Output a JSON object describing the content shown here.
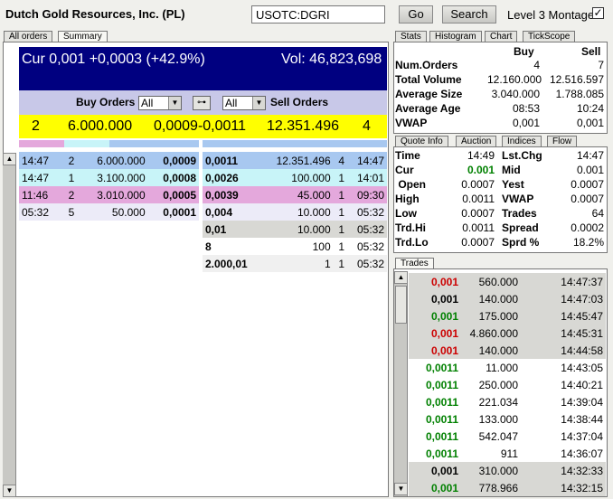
{
  "header": {
    "company": "Dutch Gold Resources, Inc. (PL)",
    "symbol": "USOTC:DGRI",
    "go_label": "Go",
    "search_label": "Search",
    "level3_label": "Level 3 Montage",
    "level3_checked": "✓"
  },
  "left_tabs": [
    "All orders",
    "Summary"
  ],
  "summary": {
    "cur": "Cur 0,001 +0,0003 (+42.9%)",
    "vol": "Vol: 46,823,698",
    "buy_orders_label": "Buy Orders",
    "sell_orders_label": "Sell Orders",
    "buy_filter": "All",
    "sell_filter": "All",
    "buy_count": "2",
    "buy_size": "6.000.000",
    "spread": "0,0009-0,0011",
    "sell_size": "12.351.496",
    "sell_count": "4"
  },
  "bids": [
    {
      "time": "14:47",
      "n": "2",
      "size": "6.000.000",
      "price": "0,0009",
      "bg": "#a8c8f0"
    },
    {
      "time": "14:47",
      "n": "1",
      "size": "3.100.000",
      "price": "0,0008",
      "bg": "#c8f4f8"
    },
    {
      "time": "11:46",
      "n": "2",
      "size": "3.010.000",
      "price": "0,0005",
      "bg": "#e4a8dc"
    },
    {
      "time": "05:32",
      "n": "5",
      "size": "50.000",
      "price": "0,0001",
      "bg": "#ecebf8"
    }
  ],
  "asks": [
    {
      "price": "0,0011",
      "size": "12.351.496",
      "n": "4",
      "time": "14:47",
      "bg": "#a8c8f0"
    },
    {
      "price": "0,0026",
      "size": "100.000",
      "n": "1",
      "time": "14:01",
      "bg": "#c8f4f8"
    },
    {
      "price": "0,0039",
      "size": "45.000",
      "n": "1",
      "time": "09:30",
      "bg": "#e4a8dc"
    },
    {
      "price": "0,004",
      "size": "10.000",
      "n": "1",
      "time": "05:32",
      "bg": "#ecebf8"
    },
    {
      "price": "0,01",
      "size": "10.000",
      "n": "1",
      "time": "05:32",
      "bg": "#d8d8d4"
    },
    {
      "price": "8",
      "size": "100",
      "n": "1",
      "time": "05:32",
      "bg": "#ffffff"
    },
    {
      "price": "2.000,01",
      "size": "1",
      "n": "1",
      "time": "05:32",
      "bg": "#f0f0f0"
    }
  ],
  "stats_tabs": [
    "Stats",
    "Histogram",
    "Chart",
    "TickScope"
  ],
  "stats": {
    "buy_label": "Buy",
    "sell_label": "Sell",
    "rows": [
      {
        "label": "Num.Orders",
        "buy": "4",
        "sell": "7"
      },
      {
        "label": "Total Volume",
        "buy": "12.160.000",
        "sell": "12.516.597"
      },
      {
        "label": "Average Size",
        "buy": "3.040.000",
        "sell": "1.788.085"
      },
      {
        "label": "Average Age",
        "buy": "08:53",
        "sell": "10:24"
      },
      {
        "label": "VWAP",
        "buy": "0,001",
        "sell": "0,001"
      }
    ]
  },
  "quote_tabs": [
    "Quote Info",
    "Auction",
    "Indices",
    "Flow"
  ],
  "quote": {
    "rows": [
      {
        "l1": "Time",
        "v1": "14:49",
        "l2": "Lst.Chg",
        "v2": "14:47"
      },
      {
        "l1": "Cur",
        "v1": "0.001",
        "l2": "Mid",
        "v2": "0.001"
      },
      {
        "l1": " Open",
        "v1": "0.0007",
        "l2": "Yest",
        "v2": "0.0007"
      },
      {
        "l1": "High",
        "v1": "0.0011",
        "l2": "VWAP",
        "v2": "0.0007"
      },
      {
        "l1": "Low",
        "v1": "0.0007",
        "l2": "Trades",
        "v2": "64"
      },
      {
        "l1": "Trd.Hi",
        "v1": "0.0011",
        "l2": "Spread",
        "v2": "0.0002"
      },
      {
        "l1": "Trd.Lo",
        "v1": "0.0007",
        "l2": "Sprd %",
        "v2": "18.2%"
      }
    ],
    "cur_color": "#008000"
  },
  "trades_tab": "Trades",
  "trades": [
    {
      "price": "0,001",
      "size": "560.000",
      "time": "14:47:37",
      "color": "#cc0000",
      "bg": "#d8d8d4"
    },
    {
      "price": "0,001",
      "size": "140.000",
      "time": "14:47:03",
      "color": "#000000",
      "bg": "#d8d8d4"
    },
    {
      "price": "0,001",
      "size": "175.000",
      "time": "14:45:47",
      "color": "#008000",
      "bg": "#d8d8d4"
    },
    {
      "price": "0,001",
      "size": "4.860.000",
      "time": "14:45:31",
      "color": "#cc0000",
      "bg": "#d8d8d4"
    },
    {
      "price": "0,001",
      "size": "140.000",
      "time": "14:44:58",
      "color": "#cc0000",
      "bg": "#d8d8d4"
    },
    {
      "price": "0,0011",
      "size": "11.000",
      "time": "14:43:05",
      "color": "#008000",
      "bg": "#ffffff"
    },
    {
      "price": "0,0011",
      "size": "250.000",
      "time": "14:40:21",
      "color": "#008000",
      "bg": "#ffffff"
    },
    {
      "price": "0,0011",
      "size": "221.034",
      "time": "14:39:04",
      "color": "#008000",
      "bg": "#ffffff"
    },
    {
      "price": "0,0011",
      "size": "133.000",
      "time": "14:38:44",
      "color": "#008000",
      "bg": "#ffffff"
    },
    {
      "price": "0,0011",
      "size": "542.047",
      "time": "14:37:04",
      "color": "#008000",
      "bg": "#ffffff"
    },
    {
      "price": "0,0011",
      "size": "911",
      "time": "14:36:07",
      "color": "#008000",
      "bg": "#ffffff"
    },
    {
      "price": "0,001",
      "size": "310.000",
      "time": "14:32:33",
      "color": "#000000",
      "bg": "#d8d8d4"
    },
    {
      "price": "0,001",
      "size": "778.966",
      "time": "14:32:15",
      "color": "#008000",
      "bg": "#d8d8d4"
    }
  ]
}
